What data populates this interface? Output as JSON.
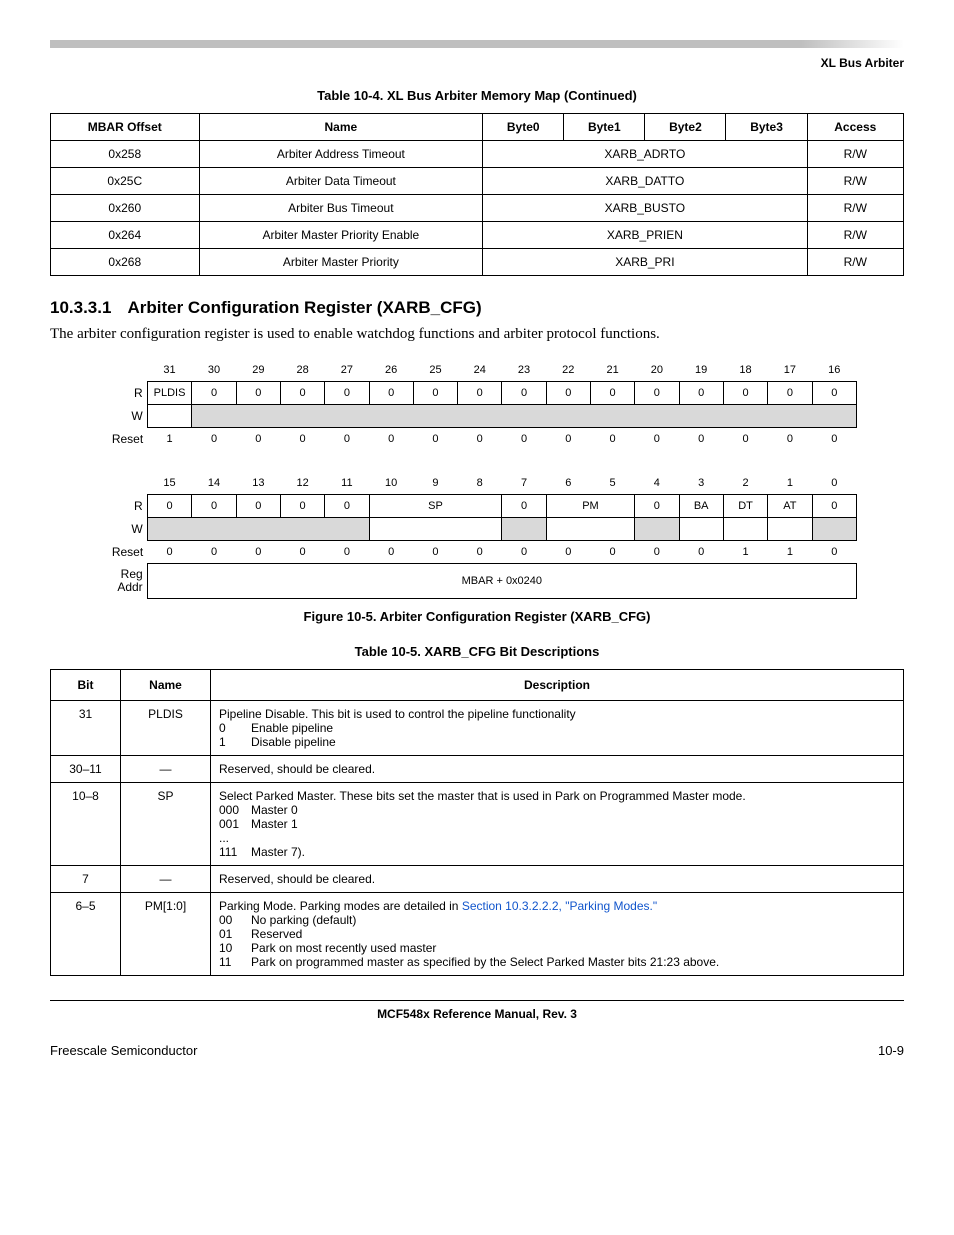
{
  "running_head": "XL Bus Arbiter",
  "table10_4": {
    "caption": "Table 10-4. XL Bus Arbiter Memory Map (Continued)",
    "headers": {
      "c0": "MBAR Offset",
      "c1": "Name",
      "c2": "Byte0",
      "c3": "Byte1",
      "c4": "Byte2",
      "c5": "Byte3",
      "c6": "Access"
    },
    "rows": [
      {
        "off": "0x258",
        "name": "Arbiter Address Timeout",
        "reg": "XARB_ADRTO",
        "access": "R/W"
      },
      {
        "off": "0x25C",
        "name": "Arbiter Data Timeout",
        "reg": "XARB_DATTO",
        "access": "R/W"
      },
      {
        "off": "0x260",
        "name": "Arbiter Bus Timeout",
        "reg": "XARB_BUSTO",
        "access": "R/W"
      },
      {
        "off": "0x264",
        "name": "Arbiter Master Priority Enable",
        "reg": "XARB_PRIEN",
        "access": "R/W"
      },
      {
        "off": "0x268",
        "name": "Arbiter Master Priority",
        "reg": "XARB_PRI",
        "access": "R/W"
      }
    ]
  },
  "section": {
    "num": "10.3.3.1",
    "title": "Arbiter Configuration Register (XARB_CFG)",
    "body": "The arbiter configuration register is used to enable watchdog functions and arbiter protocol functions."
  },
  "fig10_5": {
    "caption": "Figure 10-5. Arbiter Configuration Register (XARB_CFG)",
    "labels": {
      "R": "R",
      "W": "W",
      "Reset": "Reset",
      "RegAddr1": "Reg",
      "RegAddr2": "Addr"
    },
    "hi_bits": [
      "31",
      "30",
      "29",
      "28",
      "27",
      "26",
      "25",
      "24",
      "23",
      "22",
      "21",
      "20",
      "19",
      "18",
      "17",
      "16"
    ],
    "hi_R": [
      "PLDIS",
      "0",
      "0",
      "0",
      "0",
      "0",
      "0",
      "0",
      "0",
      "0",
      "0",
      "0",
      "0",
      "0",
      "0",
      "0"
    ],
    "hi_Reset": [
      "1",
      "0",
      "0",
      "0",
      "0",
      "0",
      "0",
      "0",
      "0",
      "0",
      "0",
      "0",
      "0",
      "0",
      "0",
      "0"
    ],
    "lo_bits": [
      "15",
      "14",
      "13",
      "12",
      "11",
      "10",
      "9",
      "8",
      "7",
      "6",
      "5",
      "4",
      "3",
      "2",
      "1",
      "0"
    ],
    "lo_R": [
      "0",
      "0",
      "0",
      "0",
      "0",
      "SP",
      "SP",
      "SP",
      "0",
      "PM",
      "PM",
      "0",
      "BA",
      "DT",
      "AT",
      "0"
    ],
    "lo_R_text": {
      "b0_4": "0",
      "sp": "SP",
      "b7": "0",
      "pm": "PM",
      "b4": "0",
      "ba": "BA",
      "dt": "DT",
      "at": "AT",
      "b0": "0"
    },
    "lo_Reset": [
      "0",
      "0",
      "0",
      "0",
      "0",
      "0",
      "0",
      "0",
      "0",
      "0",
      "0",
      "0",
      "0",
      "1",
      "1",
      "0"
    ],
    "addr": "MBAR + 0x0240"
  },
  "table10_5": {
    "caption": "Table 10-5. XARB_CFG Bit Descriptions",
    "headers": {
      "c0": "Bit",
      "c1": "Name",
      "c2": "Description"
    },
    "rows": [
      {
        "bit": "31",
        "name": "PLDIS",
        "desc": "Pipeline Disable. This bit is used to control the pipeline functionality",
        "opts": [
          {
            "k": "0",
            "v": "Enable pipeline"
          },
          {
            "k": "1",
            "v": "Disable pipeline"
          }
        ]
      },
      {
        "bit": "30–11",
        "name": "—",
        "desc": "Reserved, should be cleared."
      },
      {
        "bit": "10–8",
        "name": "SP",
        "desc": "Select Parked Master. These bits set the master that is used in Park on Programmed Master mode.",
        "opts": [
          {
            "k": "000",
            "v": "Master 0"
          },
          {
            "k": "001",
            "v": "Master 1"
          },
          {
            "k": "...",
            "v": ""
          },
          {
            "k": "111",
            "v": "Master 7)."
          }
        ]
      },
      {
        "bit": "7",
        "name": "—",
        "desc": "Reserved, should be cleared."
      },
      {
        "bit": "6–5",
        "name": "PM[1:0]",
        "desc_pre": "Parking Mode. Parking modes are detailed in ",
        "link": "Section 10.3.2.2.2, \"Parking Modes.\"",
        "opts": [
          {
            "k": "00",
            "v": "No parking (default)"
          },
          {
            "k": "01",
            "v": "Reserved"
          },
          {
            "k": "10",
            "v": "Park on most recently used master"
          },
          {
            "k": "11",
            "v": "Park on programmed master as specified by the Select Parked Master bits 21:23 above."
          }
        ]
      }
    ]
  },
  "footer": {
    "title": "MCF548x Reference Manual, Rev. 3",
    "left": "Freescale Semiconductor",
    "right": "10-9"
  }
}
